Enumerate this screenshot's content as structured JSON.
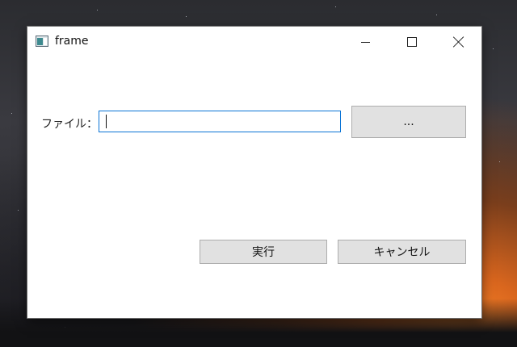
{
  "window": {
    "title": "frame",
    "icon": "app-window-icon",
    "controls": {
      "minimize_icon": "minimize-icon",
      "maximize_icon": "maximize-icon",
      "close_icon": "close-icon"
    }
  },
  "form": {
    "file_label": "ファイル：",
    "file_input": {
      "value": "",
      "placeholder": ""
    },
    "browse_label": "...",
    "run_label": "実行",
    "cancel_label": "キャンセル"
  },
  "colors": {
    "input_focus_border": "#0a74d6",
    "button_bg": "#e1e1e1",
    "button_border": "#adadad",
    "window_bg": "#ffffff"
  }
}
